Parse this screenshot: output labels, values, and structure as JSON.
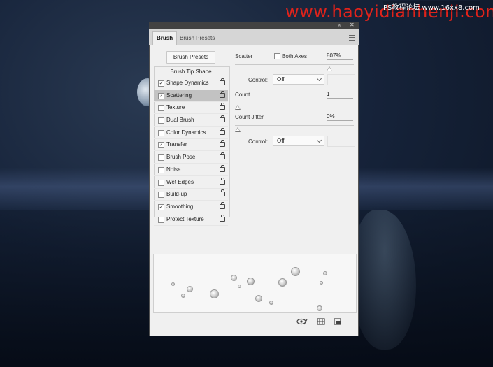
{
  "watermark": {
    "main": "www.haoyidianhenji.com",
    "secondary": "PS教程论坛 www.16xx8.com"
  },
  "titlebar": {
    "collapse_icon": "double-chevron-icon",
    "close_glyph": "✕",
    "collapse_glyph": "«"
  },
  "tabs": [
    {
      "label": "Brush",
      "active": true
    },
    {
      "label": "Brush Presets",
      "active": false
    }
  ],
  "left": {
    "presets_button": "Brush Presets",
    "header": "Brush Tip Shape",
    "options": [
      {
        "label": "Shape Dynamics",
        "checked": true,
        "selected": false
      },
      {
        "label": "Scattering",
        "checked": true,
        "selected": true
      },
      {
        "label": "Texture",
        "checked": false,
        "selected": false
      },
      {
        "label": "Dual Brush",
        "checked": false,
        "selected": false
      },
      {
        "label": "Color Dynamics",
        "checked": false,
        "selected": false
      },
      {
        "label": "Transfer",
        "checked": true,
        "selected": false
      },
      {
        "label": "Brush Pose",
        "checked": false,
        "selected": false
      },
      {
        "label": "Noise",
        "checked": false,
        "selected": false
      },
      {
        "label": "Wet Edges",
        "checked": false,
        "selected": false
      },
      {
        "label": "Build-up",
        "checked": false,
        "selected": false
      },
      {
        "label": "Smoothing",
        "checked": true,
        "selected": false
      },
      {
        "label": "Protect Texture",
        "checked": false,
        "selected": false
      }
    ]
  },
  "right": {
    "scatter_label": "Scatter",
    "both_axes_label": "Both Axes",
    "both_axes_checked": false,
    "scatter_value": "807%",
    "scatter_level": 0.807,
    "control1_label": "Control:",
    "control1_value": "Off",
    "count_label": "Count",
    "count_value": "1",
    "count_level": 0,
    "count_jitter_label": "Count Jitter",
    "count_jitter_value": "0%",
    "count_jitter_level": 0,
    "control2_label": "Control:",
    "control2_value": "Off"
  },
  "footer": {
    "icons": [
      "eye-brush-icon",
      "grid-panel-icon",
      "new-preset-icon"
    ]
  }
}
